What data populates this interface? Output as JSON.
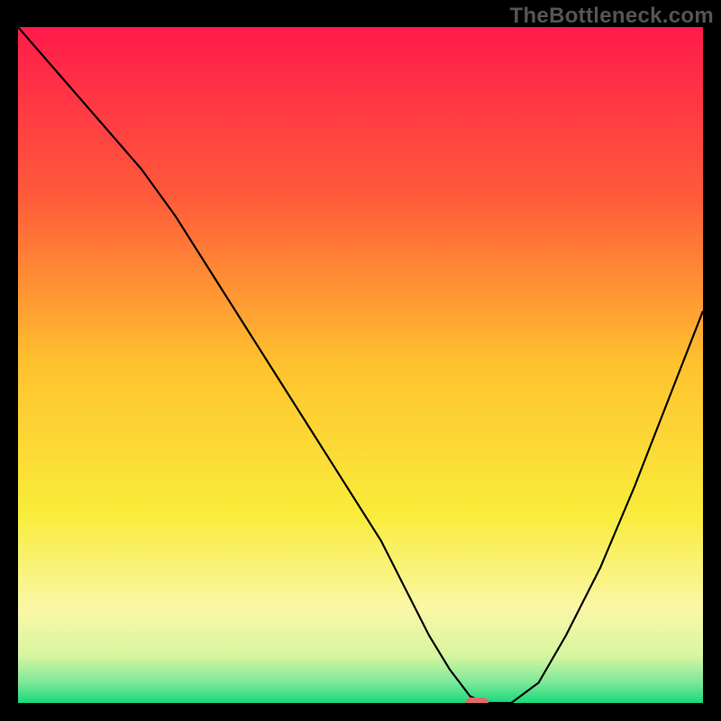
{
  "watermark": "TheBottleneck.com",
  "chart_data": {
    "type": "line",
    "title": "",
    "xlabel": "",
    "ylabel": "",
    "xlim": [
      0,
      100
    ],
    "ylim": [
      0,
      100
    ],
    "grid": false,
    "series": [
      {
        "name": "bottleneck-curve",
        "x": [
          0,
          6,
          12,
          18,
          23,
          28,
          33,
          38,
          43,
          48,
          53,
          57,
          60,
          63,
          66,
          68,
          72,
          76,
          80,
          85,
          90,
          95,
          100
        ],
        "y": [
          100,
          93,
          86,
          79,
          72,
          64,
          56,
          48,
          40,
          32,
          24,
          16,
          10,
          5,
          1,
          0,
          0,
          3,
          10,
          20,
          32,
          45,
          58
        ]
      }
    ],
    "annotations": [
      {
        "name": "optimal-marker",
        "x": 67,
        "y": 0
      }
    ],
    "background": {
      "type": "vertical-gradient",
      "stops": [
        {
          "pos": 0.0,
          "color": "#ff1a4b"
        },
        {
          "pos": 0.25,
          "color": "#ff5a3a"
        },
        {
          "pos": 0.5,
          "color": "#ffc22e"
        },
        {
          "pos": 0.72,
          "color": "#f9ec3a"
        },
        {
          "pos": 0.86,
          "color": "#faf7a6"
        },
        {
          "pos": 0.93,
          "color": "#d8f6a0"
        },
        {
          "pos": 0.97,
          "color": "#7be89a"
        },
        {
          "pos": 1.0,
          "color": "#17d97a"
        }
      ]
    }
  }
}
